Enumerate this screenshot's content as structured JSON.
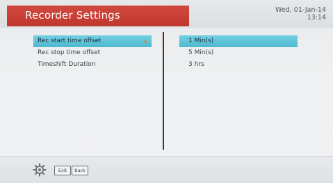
{
  "header": {
    "title": "Recorder Settings",
    "date": "Wed, 01-Jan-14",
    "time": "13:14"
  },
  "settings": [
    {
      "label": "Rec start time offset",
      "value": "1 Min(s)",
      "selected": true
    },
    {
      "label": "Rec stop time offset",
      "value": "5 Min(s)",
      "selected": false
    },
    {
      "label": "Timeshift Duration",
      "value": "3 hrs",
      "selected": false
    }
  ],
  "footer": {
    "icons": [
      "gear-icon"
    ],
    "exit_label": "Exit",
    "back_label": "Back"
  },
  "colors": {
    "title_bg": "#c73d33",
    "selection": "#4db8cf",
    "arrow": "#d38b2a"
  }
}
